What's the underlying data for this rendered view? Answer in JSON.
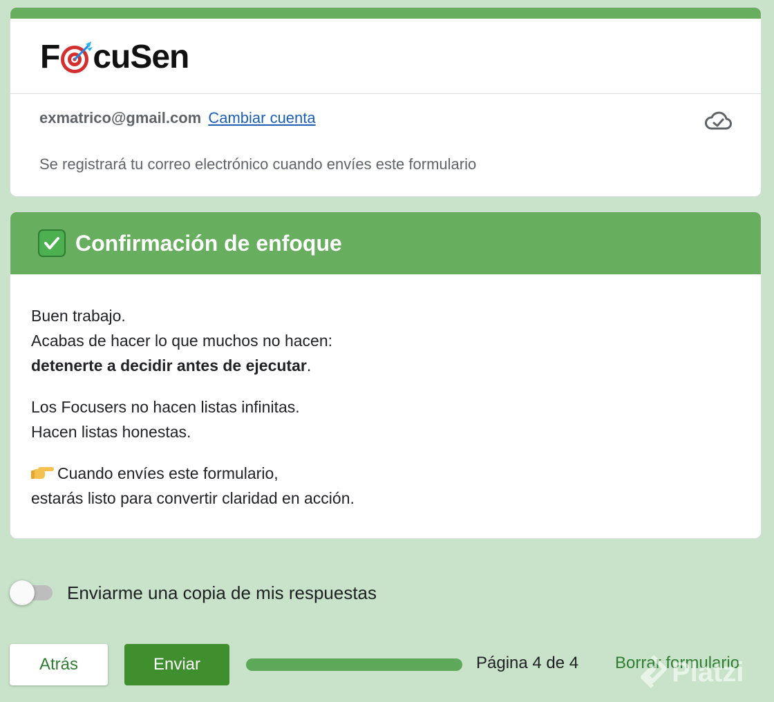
{
  "header": {
    "logo_text_left": "F",
    "logo_text_right": "cuSen",
    "logo_icon": "dart-target-icon",
    "account_email": "exmatrico@gmail.com",
    "switch_account_label": "Cambiar cuenta",
    "saved_icon": "cloud-check-icon",
    "notice": "Se registrará tu correo electrónico cuando envíes este formulario"
  },
  "section": {
    "title": "Confirmación de enfoque",
    "title_icon": "check-mark-button-icon",
    "line1": "Buen trabajo.",
    "line2": "Acabas de hacer lo que muchos no hacen:",
    "line3_bold": "detenerte a decidir antes de ejecutar",
    "line3_end": ".",
    "line4": "Los Focusers no hacen listas infinitas.",
    "line5": "Hacen listas honestas.",
    "line6": "Cuando envíes este formulario,",
    "line6_icon": "pointing-hand-icon",
    "line7": "estarás listo para convertir claridad en acción."
  },
  "copy_toggle": {
    "label": "Enviarme una copia de mis respuestas",
    "on": false
  },
  "footer": {
    "back_label": "Atrás",
    "send_label": "Enviar",
    "progress_fraction": 1.0,
    "page_label": "Página 4 de 4",
    "clear_label": "Borrar formulario"
  },
  "watermark": {
    "text": "Platzi"
  },
  "colors": {
    "accent": "#67ae5e",
    "background": "#c8e3c9",
    "primary_button": "#3f8f2f",
    "link": "#1a5fb4"
  }
}
